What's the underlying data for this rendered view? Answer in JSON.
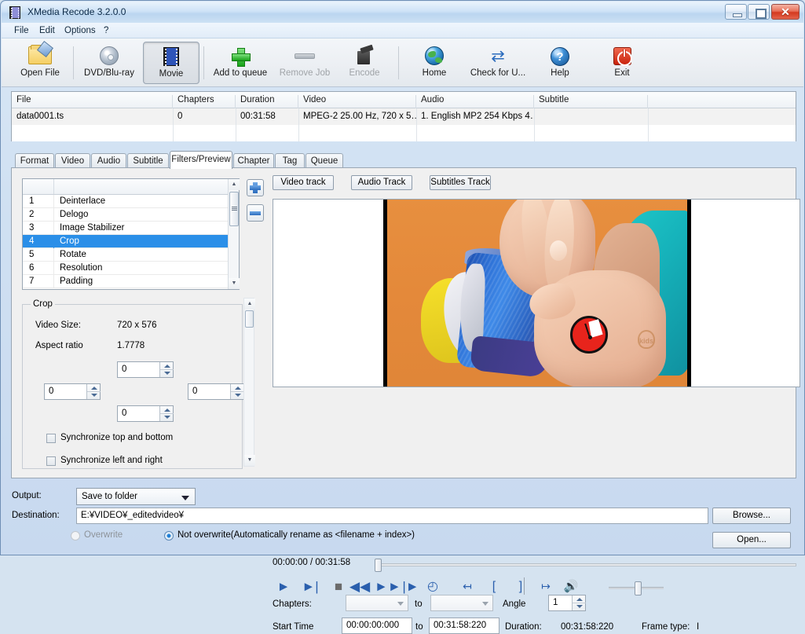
{
  "window": {
    "title": "XMedia Recode 3.2.0.0",
    "icon": "film-strip-icon",
    "minimize_label": "–",
    "maximize_label": "□",
    "close_label": "✕"
  },
  "menu": {
    "items": [
      "File",
      "Edit",
      "Options",
      "?"
    ]
  },
  "toolbar": {
    "buttons": [
      {
        "label": "Open File",
        "icon": "open-folder-icon",
        "state": "enabled"
      },
      {
        "label": "DVD/Blu-ray",
        "icon": "disc-icon",
        "state": "enabled"
      },
      {
        "label": "Movie",
        "icon": "film-icon",
        "state": "pressed"
      },
      {
        "label": "Add to queue",
        "icon": "green-plus-icon",
        "state": "enabled"
      },
      {
        "label": "Remove Job",
        "icon": "grey-dash-icon",
        "state": "disabled"
      },
      {
        "label": "Encode",
        "icon": "encoder-icon",
        "state": "disabled"
      },
      {
        "label": "Home",
        "icon": "globe-icon",
        "state": "enabled"
      },
      {
        "label": "Check for U...",
        "icon": "refresh-icon",
        "state": "enabled"
      },
      {
        "label": "Help",
        "icon": "question-circle-icon",
        "state": "enabled"
      },
      {
        "label": "Exit",
        "icon": "power-icon",
        "state": "enabled"
      }
    ]
  },
  "file_list": {
    "columns": [
      "File",
      "Chapters",
      "Duration",
      "Video",
      "Audio",
      "Subtitle",
      ""
    ],
    "rows": [
      {
        "file": "data0001.ts",
        "chapters": "0",
        "duration": "00:31:58",
        "video": "MPEG-2 25.00 Hz, 720 x 5…",
        "audio": "1. English MP2 254 Kbps 4…",
        "subtitle": "",
        "extra": ""
      },
      {
        "file": "",
        "chapters": "",
        "duration": "",
        "video": "",
        "audio": "",
        "subtitle": "",
        "extra": ""
      }
    ]
  },
  "tabs": {
    "items": [
      "Format",
      "Video",
      "Audio",
      "Subtitle",
      "Filters/Preview",
      "Chapter",
      "Tag",
      "Queue"
    ],
    "active": "Filters/Preview"
  },
  "filters": {
    "add_label": "+",
    "remove_label": "–",
    "rows": [
      {
        "num": "1",
        "name": "Deinterlace"
      },
      {
        "num": "2",
        "name": "Delogo"
      },
      {
        "num": "3",
        "name": "Image Stabilizer"
      },
      {
        "num": "4",
        "name": "Crop"
      },
      {
        "num": "5",
        "name": "Rotate"
      },
      {
        "num": "6",
        "name": "Resolution"
      },
      {
        "num": "7",
        "name": "Padding"
      }
    ],
    "selected_index": 3
  },
  "crop": {
    "legend": "Crop",
    "video_size_label": "Video Size:",
    "video_size_value": "720 x 576",
    "aspect_label": "Aspect ratio",
    "aspect_value": "1.7778",
    "top_value": "0",
    "left_value": "0",
    "right_value": "0",
    "bottom_value": "0",
    "sync_top_bottom": "Synchronize top and bottom",
    "sync_left_right": "Synchronize left and right",
    "sync_top_bottom_checked": false,
    "sync_left_right_checked": false
  },
  "preview": {
    "track_buttons": [
      "Video track",
      "Audio Track",
      "Subtitles Track"
    ],
    "timecode_current": "00:00:00",
    "timecode_total": "00:31:58",
    "timecode_display": "00:00:00 / 00:31:58",
    "transport_icons": [
      "play-icon",
      "next-frame-icon",
      "stop-icon",
      "rewind-icon",
      "fast-forward-icon",
      "frame-step-icon",
      "clock-icon",
      "jump-in-icon",
      "mark-in-icon",
      "mark-out-icon",
      "jump-out-icon",
      "volume-icon"
    ],
    "scene": {
      "background_color": "#e08a3c",
      "pillarbox_color": "#000000",
      "overlay_badge": "red-clock-overlay",
      "watermark_text": "kids"
    }
  },
  "chapters_row": {
    "chapters_label": "Chapters:",
    "to_label": "to",
    "chapter_from": "",
    "chapter_to": "",
    "angle_label": "Angle",
    "angle_value": "1",
    "start_time_label": "Start Time",
    "start_time_value": "00:00:00:000",
    "end_time_value": "00:31:58:220",
    "duration_label": "Duration:",
    "duration_value": "00:31:58:220",
    "frame_type_label": "Frame type:",
    "frame_type_value": "I"
  },
  "output": {
    "output_label": "Output:",
    "output_value": "Save to folder",
    "destination_label": "Destination:",
    "destination_value": "E:¥VIDEO¥_editedvideo¥",
    "browse_label": "Browse...",
    "open_label": "Open...",
    "overwrite_label": "Overwrite",
    "not_overwrite_label": "Not overwrite(Automatically rename as <filename + index>)",
    "overwrite_selected": false,
    "not_overwrite_selected": true
  },
  "colors": {
    "selection_blue": "#2a8fe8",
    "accent_blue": "#2a5fad",
    "title_gradient_top": "#e9f3fc",
    "close_red": "#d4391f"
  }
}
